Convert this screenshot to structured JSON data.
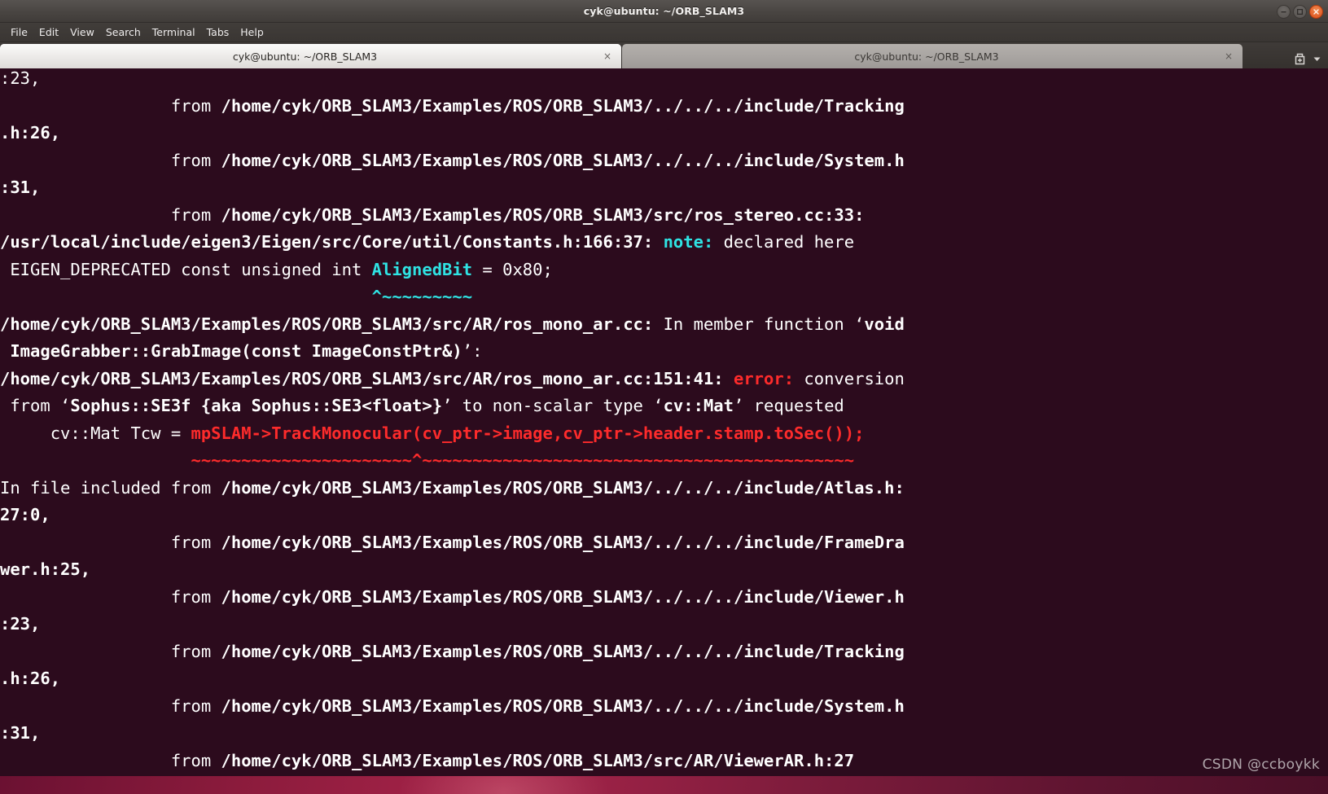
{
  "window": {
    "title": "cyk@ubuntu: ~/ORB_SLAM3",
    "controls": {
      "minimize_label": "minimize",
      "maximize_label": "maximize",
      "close_label": "close"
    }
  },
  "menubar": {
    "items": [
      {
        "label": "File"
      },
      {
        "label": "Edit"
      },
      {
        "label": "View"
      },
      {
        "label": "Search"
      },
      {
        "label": "Terminal"
      },
      {
        "label": "Tabs"
      },
      {
        "label": "Help"
      }
    ]
  },
  "tabbar": {
    "tabs": [
      {
        "label": "cyk@ubuntu: ~/ORB_SLAM3",
        "close_label": "×",
        "active": true
      },
      {
        "label": "cyk@ubuntu: ~/ORB_SLAM3",
        "close_label": "×",
        "active": false
      }
    ],
    "new_tab_label": "+",
    "tab_menu_label": "▼"
  },
  "colors": {
    "terminal_background": "#2c0b1d",
    "terminal_foreground": "#ffffff",
    "note_cyan": "#2fe3e3",
    "error_red": "#fd2b2b",
    "titlebar": "#494542",
    "close_button": "#db4b16"
  },
  "terminal": {
    "lines": [
      [
        {
          "t": ":23,",
          "s": "wh"
        }
      ],
      [
        {
          "t": "                 from ",
          "s": "wh"
        },
        {
          "t": "/home/cyk/ORB_SLAM3/Examples/ROS/ORB_SLAM3/../../../include/Tracking",
          "s": "b"
        }
      ],
      [
        {
          "t": ".h:26,",
          "s": "b"
        }
      ],
      [
        {
          "t": "                 from ",
          "s": "wh"
        },
        {
          "t": "/home/cyk/ORB_SLAM3/Examples/ROS/ORB_SLAM3/../../../include/System.h",
          "s": "b"
        }
      ],
      [
        {
          "t": ":31,",
          "s": "b"
        }
      ],
      [
        {
          "t": "                 from ",
          "s": "wh"
        },
        {
          "t": "/home/cyk/ORB_SLAM3/Examples/ROS/ORB_SLAM3/src/ros_stereo.cc:33:",
          "s": "b"
        }
      ],
      [
        {
          "t": "/usr/local/include/eigen3/Eigen/src/Core/util/Constants.h:166:37: ",
          "s": "b"
        },
        {
          "t": "note:",
          "s": "cy"
        },
        {
          "t": " declared here",
          "s": "wh"
        }
      ],
      [
        {
          "t": " EIGEN_DEPRECATED const unsigned int ",
          "s": "wh"
        },
        {
          "t": "AlignedBit",
          "s": "cy"
        },
        {
          "t": " = 0x80;",
          "s": "wh"
        }
      ],
      [
        {
          "t": "                                     ",
          "s": "wh"
        },
        {
          "t": "^~~~~~~~~~",
          "s": "cy"
        }
      ],
      [
        {
          "t": "/home/cyk/ORB_SLAM3/Examples/ROS/ORB_SLAM3/src/AR/ros_mono_ar.cc: ",
          "s": "b"
        },
        {
          "t": "In member function ‘",
          "s": "wh"
        },
        {
          "t": "void",
          "s": "b"
        }
      ],
      [
        {
          "t": " ImageGrabber::GrabImage(const ImageConstPtr&)",
          "s": "b"
        },
        {
          "t": "’:",
          "s": "wh"
        }
      ],
      [
        {
          "t": "/home/cyk/ORB_SLAM3/Examples/ROS/ORB_SLAM3/src/AR/ros_mono_ar.cc:151:41: ",
          "s": "b"
        },
        {
          "t": "error:",
          "s": "rd"
        },
        {
          "t": " conversion",
          "s": "wh"
        }
      ],
      [
        {
          "t": " from ‘",
          "s": "wh"
        },
        {
          "t": "Sophus::SE3f {aka Sophus::SE3<float>}",
          "s": "b"
        },
        {
          "t": "’ to non-scalar type ‘",
          "s": "wh"
        },
        {
          "t": "cv::Mat",
          "s": "b"
        },
        {
          "t": "’ requested",
          "s": "wh"
        }
      ],
      [
        {
          "t": "     cv::Mat Tcw = ",
          "s": "wh"
        },
        {
          "t": "mpSLAM->TrackMonocular(cv_ptr->image,cv_ptr->header.stamp.toSec());",
          "s": "rd"
        }
      ],
      [
        {
          "t": "                   ",
          "s": "wh"
        },
        {
          "t": "~~~~~~~~~~~~~~~~~~~~~~^~~~~~~~~~~~~~~~~~~~~~~~~~~~~~~~~~~~~~~~~~~~",
          "s": "rd"
        }
      ],
      [
        {
          "t": "In file included from ",
          "s": "wh"
        },
        {
          "t": "/home/cyk/ORB_SLAM3/Examples/ROS/ORB_SLAM3/../../../include/Atlas.h:",
          "s": "b"
        }
      ],
      [
        {
          "t": "27:0,",
          "s": "b"
        }
      ],
      [
        {
          "t": "                 from ",
          "s": "wh"
        },
        {
          "t": "/home/cyk/ORB_SLAM3/Examples/ROS/ORB_SLAM3/../../../include/FrameDra",
          "s": "b"
        }
      ],
      [
        {
          "t": "wer.h:25,",
          "s": "b"
        }
      ],
      [
        {
          "t": "                 from ",
          "s": "wh"
        },
        {
          "t": "/home/cyk/ORB_SLAM3/Examples/ROS/ORB_SLAM3/../../../include/Viewer.h",
          "s": "b"
        }
      ],
      [
        {
          "t": ":23,",
          "s": "b"
        }
      ],
      [
        {
          "t": "                 from ",
          "s": "wh"
        },
        {
          "t": "/home/cyk/ORB_SLAM3/Examples/ROS/ORB_SLAM3/../../../include/Tracking",
          "s": "b"
        }
      ],
      [
        {
          "t": ".h:26,",
          "s": "b"
        }
      ],
      [
        {
          "t": "                 from ",
          "s": "wh"
        },
        {
          "t": "/home/cyk/ORB_SLAM3/Examples/ROS/ORB_SLAM3/../../../include/System.h",
          "s": "b"
        }
      ],
      [
        {
          "t": ":31,",
          "s": "b"
        }
      ],
      [
        {
          "t": "                 from ",
          "s": "wh"
        },
        {
          "t": "/home/cyk/ORB_SLAM3/Examples/ROS/ORB_SLAM3/src/AR/ViewerAR.h:27",
          "s": "b"
        }
      ]
    ]
  },
  "watermark": {
    "text": "CSDN @ccboykk"
  }
}
